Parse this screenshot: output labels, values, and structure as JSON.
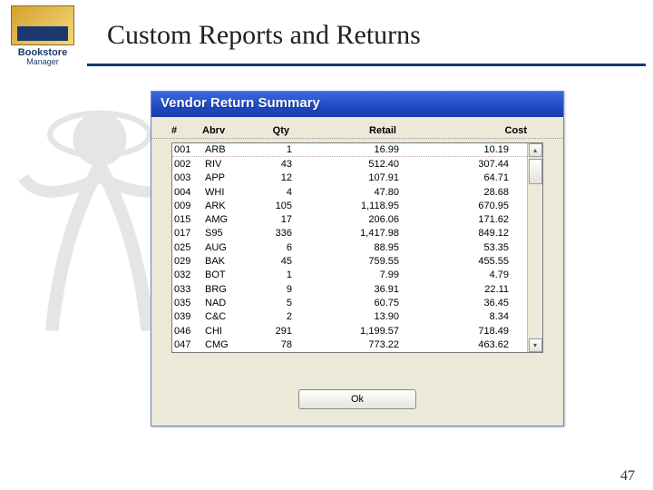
{
  "header": {
    "logo_line1": "Bookstore",
    "logo_line2": "Manager",
    "title": "Custom Reports and Returns"
  },
  "window": {
    "title": "Vendor Return Summary",
    "columns": {
      "num": "#",
      "abrv": "Abrv",
      "qty": "Qty",
      "retail": "Retail",
      "cost": "Cost"
    },
    "rows": [
      {
        "num": "001",
        "abrv": "ARB",
        "qty": "1",
        "retail": "16.99",
        "cost": "10.19"
      },
      {
        "num": "002",
        "abrv": "RIV",
        "qty": "43",
        "retail": "512.40",
        "cost": "307.44"
      },
      {
        "num": "003",
        "abrv": "APP",
        "qty": "12",
        "retail": "107.91",
        "cost": "64.71"
      },
      {
        "num": "004",
        "abrv": "WHI",
        "qty": "4",
        "retail": "47.80",
        "cost": "28.68"
      },
      {
        "num": "009",
        "abrv": "ARK",
        "qty": "105",
        "retail": "1,118.95",
        "cost": "670.95"
      },
      {
        "num": "015",
        "abrv": "AMG",
        "qty": "17",
        "retail": "206.06",
        "cost": "171.62"
      },
      {
        "num": "017",
        "abrv": "S95",
        "qty": "336",
        "retail": "1,417.98",
        "cost": "849.12"
      },
      {
        "num": "025",
        "abrv": "AUG",
        "qty": "6",
        "retail": "88.95",
        "cost": "53.35"
      },
      {
        "num": "029",
        "abrv": "BAK",
        "qty": "45",
        "retail": "759.55",
        "cost": "455.55"
      },
      {
        "num": "032",
        "abrv": "BOT",
        "qty": "1",
        "retail": "7.99",
        "cost": "4.79"
      },
      {
        "num": "033",
        "abrv": "BRG",
        "qty": "9",
        "retail": "36.91",
        "cost": "22.11"
      },
      {
        "num": "035",
        "abrv": "NAD",
        "qty": "5",
        "retail": "60.75",
        "cost": "36.45"
      },
      {
        "num": "039",
        "abrv": "C&C",
        "qty": "2",
        "retail": "13.90",
        "cost": "8.34"
      },
      {
        "num": "046",
        "abrv": "CHI",
        "qty": "291",
        "retail": "1,199.57",
        "cost": "718.49"
      },
      {
        "num": "047",
        "abrv": "CMG",
        "qty": "78",
        "retail": "773.22",
        "cost": "463.62"
      }
    ],
    "ok_label": "Ok"
  },
  "page_number": "47"
}
